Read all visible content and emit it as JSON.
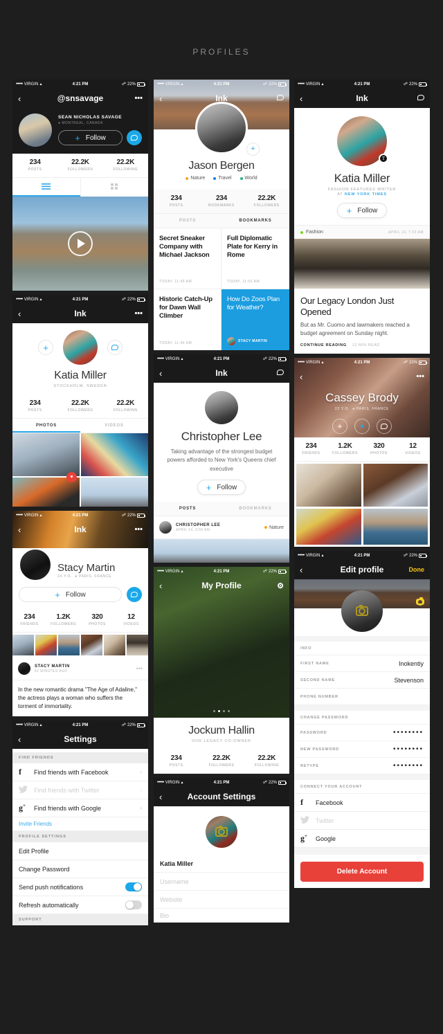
{
  "page": {
    "title": "PROFILES"
  },
  "status_bar": {
    "carrier": "VIRGIN",
    "time": "4:21 PM",
    "battery": "22%",
    "dots": "•••••"
  },
  "icons": {
    "back": "‹",
    "more": "•••",
    "chevron": "›",
    "plus": "+",
    "heart": "♥",
    "search": "⌕",
    "nyt": "T"
  },
  "screens": {
    "snsavage": {
      "nav_title": "@snsavage",
      "name": "SEAN NICHOLAS SAVAGE",
      "location": "MONTREAL, CANADA",
      "follow_label": "Follow",
      "stats": [
        {
          "value": "234",
          "label": "POSTS"
        },
        {
          "value": "22.2K",
          "label": "FOLLOWERS"
        },
        {
          "value": "22.2K",
          "label": "FOLLOWING"
        }
      ],
      "tabs": [
        {
          "label": "list-view",
          "active": true
        },
        {
          "label": "grid-view",
          "active": false
        }
      ]
    },
    "katia_photos": {
      "nav_title": "Ink",
      "name": "Katia Miller",
      "location": "STOCKHOLM, SWEDEN",
      "stats": [
        {
          "value": "234",
          "label": "POSTS"
        },
        {
          "value": "22.2K",
          "label": "FOLLOWERS"
        },
        {
          "value": "22.2K",
          "label": "FOLLOWING"
        }
      ],
      "tabs": [
        {
          "label": "PHOTOS",
          "active": true
        },
        {
          "label": "VIDEOS",
          "active": false
        }
      ]
    },
    "stacy": {
      "nav_title": "Ink",
      "name": "Stacy Martin",
      "age": "24 Y.O.",
      "location": "PARIS, FRANCE",
      "follow_label": "Follow",
      "stats": [
        {
          "value": "234",
          "label": "FRIENDS"
        },
        {
          "value": "1.2K",
          "label": "FOLLOWERS"
        },
        {
          "value": "320",
          "label": "PHOTOS"
        },
        {
          "value": "12",
          "label": "VIDEOS"
        }
      ],
      "post": {
        "author": "STACY MARTIN",
        "time": "62 MINUTES AGO",
        "text": "In the new romantic drama \"The Age of Adaline,\" the actress plays a woman who suffers the torment of immortality."
      }
    },
    "settings": {
      "nav_title": "Settings",
      "sections": [
        {
          "header": "FIND FRIENDS"
        },
        {
          "header": "PROFILE SETTINGS"
        },
        {
          "header": "SUPPORT"
        }
      ],
      "find_friends": [
        {
          "icon": "f",
          "label": "Find friends with Facebook",
          "disabled": false
        },
        {
          "icon": "twitter",
          "label": "Find friends with Twitter",
          "disabled": true
        },
        {
          "icon": "g+",
          "label": "Find friends with Google",
          "disabled": false
        }
      ],
      "invite_label": "Invite Friends",
      "profile_settings": [
        {
          "label": "Edit Profile"
        },
        {
          "label": "Change Password"
        }
      ],
      "toggles": [
        {
          "label": "Send push notifications",
          "on": true
        },
        {
          "label": "Refresh automatically",
          "on": false
        }
      ]
    },
    "jason": {
      "nav_title": "Ink",
      "name": "Jason Bergen",
      "tags": [
        {
          "label": "Nature",
          "color": "#f5a623"
        },
        {
          "label": "Travel",
          "color": "#1b7ce0"
        },
        {
          "label": "World",
          "color": "#24b47e"
        }
      ],
      "stats": [
        {
          "value": "234",
          "label": "POSTS"
        },
        {
          "value": "234",
          "label": "BOOKMARKS"
        },
        {
          "value": "22.2K",
          "label": "FOLLOWERS"
        }
      ],
      "tabs": [
        {
          "label": "POSTS",
          "active": false
        },
        {
          "label": "BOOKMARKS",
          "active": true
        }
      ],
      "bookmarks": [
        {
          "title": "Secret Sneaker Company with Michael Jackson",
          "time": "TODAY, 11:46 AM",
          "highlight": false
        },
        {
          "title": "Full Diplomatic Plate for Kerry in Rome",
          "time": "TODAY, 11:56 AM",
          "highlight": false
        },
        {
          "title": "Historic Catch-Up for Dawn Wall Climber",
          "time": "TODAY, 11:46 AM",
          "highlight": false
        },
        {
          "title": "How Do Zoos Plan for Weather?",
          "author": "STACY MARTIN",
          "highlight": true
        }
      ]
    },
    "christopher": {
      "nav_title": "Ink",
      "name": "Christopher Lee",
      "bio": "Taking advantage of the strongest budget powers afforded to New York's Queens chief executive",
      "follow_label": "Follow",
      "tabs": [
        {
          "label": "POSTS",
          "active": true
        },
        {
          "label": "BOOKMARKS",
          "active": false
        }
      ],
      "post": {
        "author": "CHRISTOPHER LEE",
        "time": "APRIL 14, 3:56 AM",
        "tag": "Nature",
        "tag_color": "#f5a623"
      }
    },
    "my_profile": {
      "nav_title": "My Profile",
      "name": "Jockum Hallin",
      "subtitle": "OUR LEGACY CO-OWNER",
      "stats": [
        {
          "value": "234",
          "label": "POSTS"
        },
        {
          "value": "22.2K",
          "label": "FOLLOWERS"
        },
        {
          "value": "22.2K",
          "label": "FOLLOWING"
        }
      ],
      "carousel_dots": 4,
      "carousel_active": 1
    },
    "account_settings": {
      "nav_title": "Account Settings",
      "name_value": "Katia Miller",
      "fields": [
        {
          "placeholder": "Username"
        },
        {
          "placeholder": "Website"
        },
        {
          "placeholder": "Bio"
        }
      ]
    },
    "katia_writer": {
      "nav_title": "Ink",
      "name": "Katia Miller",
      "role_line1": "FASHION FEATURES WRITER",
      "role_line2_prefix": "AT ",
      "role_line2_link": "NEW YORK TIMES",
      "follow_label": "Follow",
      "feed_tag": "Fashion",
      "feed_tag_color": "#7ed321",
      "feed_date": "APRIL 14, 7:32 AM",
      "article": {
        "title": "Our Legacy London Just Opened",
        "excerpt": "But as Mr. Cuomo and lawmakers reached a budget agreement on Sunday night.",
        "cta": "CONTINUE READING",
        "read_time": "12 MIN READ"
      }
    },
    "cassey": {
      "nav_title": "",
      "name": "Cassey Brody",
      "age": "22 Y.O.",
      "location": "PARIS, FRANCE",
      "stats": [
        {
          "value": "234",
          "label": "FRIENDS"
        },
        {
          "value": "1.2K",
          "label": "FOLLOWERS"
        },
        {
          "value": "320",
          "label": "PHOTOS"
        },
        {
          "value": "12",
          "label": "VIDEOS"
        }
      ]
    },
    "edit_profile": {
      "nav_title": "Edit profile",
      "done_label": "Done",
      "info_header": "INFO",
      "info_fields": [
        {
          "key": "FIRST NAME",
          "value": "Inokentiy"
        },
        {
          "key": "SECOND NAME",
          "value": "Stevenson"
        },
        {
          "key": "PHONE NUMBER",
          "value": ""
        }
      ],
      "password_header": "CHANGE PASSWORD",
      "password_fields": [
        {
          "key": "PASSWORD",
          "value": "••••••••"
        },
        {
          "key": "NEW PASSWORD",
          "value": "••••••••"
        },
        {
          "key": "RETYPE",
          "value": "••••••••"
        }
      ],
      "connect_header": "CONNECT YOUR ACCOUNT",
      "connect": [
        {
          "icon": "f",
          "label": "Facebook",
          "disabled": false
        },
        {
          "icon": "twitter",
          "label": "Twitter",
          "disabled": true
        },
        {
          "icon": "g+",
          "label": "Google",
          "disabled": false
        }
      ],
      "delete_label": "Delete Account"
    }
  }
}
